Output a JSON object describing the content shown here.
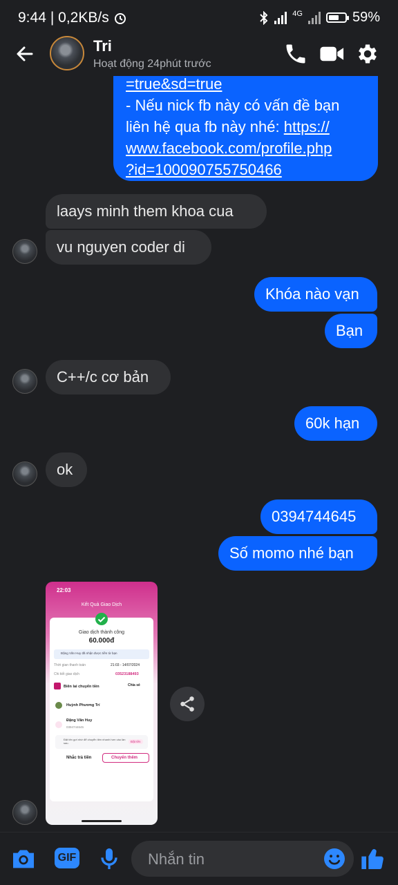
{
  "status": {
    "time": "9:44",
    "speed": "| 0,2KB/s",
    "network": "4G",
    "battery": "59%"
  },
  "header": {
    "name": "Tri",
    "activity": "Hoạt động 24phút trước"
  },
  "messages": {
    "top_partial": "=true&sd=true",
    "top_line1": "- Nếu nick fb này có vấn đề bạn",
    "top_line2_prefix": "liên hệ qua fb này nhé: ",
    "top_link1": "https://",
    "top_link2": "www.facebook.com/profile.php",
    "top_link3": "?id=100090755750466",
    "in1": "laays minh them khoa cua",
    "in2": "vu nguyen coder di",
    "out1": "Khóa nào vạn",
    "out2": "Bạn",
    "in3": "C++/c cơ bản",
    "out3": "60k hạn",
    "in4": "ok",
    "out4": "0394744645",
    "out5": "Số momo nhé bạn"
  },
  "screenshot": {
    "time": "22:03",
    "title": "Kết Quả Giao Dịch",
    "status": "Giao dịch thành công",
    "amount": "60.000đ",
    "notice": "Đặng Văn Huy đã nhận được tiền từ bạn",
    "time_label": "Thời gian thanh toán",
    "time_value": "21:03 - 14/07/2024",
    "detail_label": "Chi tiết giao dịch",
    "detail_value": "03523188493",
    "receipt": "Biên lai chuyển tiền",
    "share": "Chia sẻ",
    "sender": "Huỳnh Phương Trí",
    "receiver": "Đặng Văn Huy",
    "receiver_phone": "0394744645",
    "hint": "Đặt tên gợi nhớ để chuyển tiền nhanh hơn vào lần sau.",
    "hint_btn": "Đặt tên",
    "btn_remind": "Nhắc trả tiền",
    "btn_more": "Chuyển thêm"
  },
  "composer": {
    "placeholder": "Nhắn tin",
    "gif_label": "GIF"
  },
  "colors": {
    "outgoing": "#0a63ff",
    "incoming": "#303134",
    "accent": "#2d88ff"
  },
  "icons": [
    "back-arrow-icon",
    "phone-icon",
    "video-icon",
    "gear-icon",
    "share-icon",
    "camera-icon",
    "gif-icon",
    "microphone-icon",
    "emoji-icon",
    "thumbs-up-icon"
  ]
}
